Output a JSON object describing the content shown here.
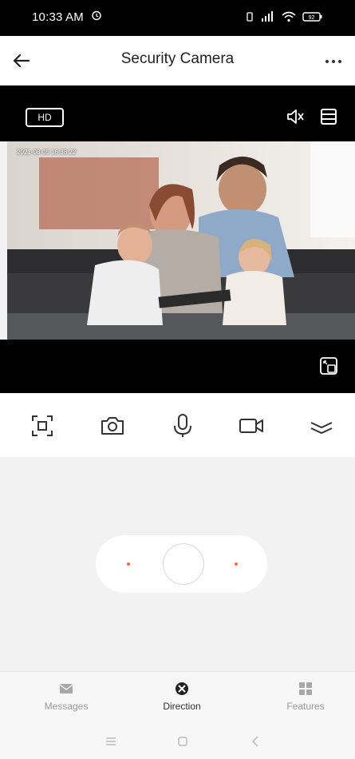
{
  "status": {
    "time": "10:33 AM",
    "battery": "92"
  },
  "header": {
    "title": "Security Camera"
  },
  "player": {
    "quality": "HD",
    "timestamp": "2021-08-05 16:38:22"
  },
  "tabs": [
    {
      "label": "Messages",
      "icon": "mail-icon"
    },
    {
      "label": "Direction",
      "icon": "direction-icon"
    },
    {
      "label": "Features",
      "icon": "grid-icon"
    }
  ],
  "colors": {
    "accent": "#ff6a3d",
    "video_bg": "#000000",
    "page_bg": "#f2f2f2"
  }
}
